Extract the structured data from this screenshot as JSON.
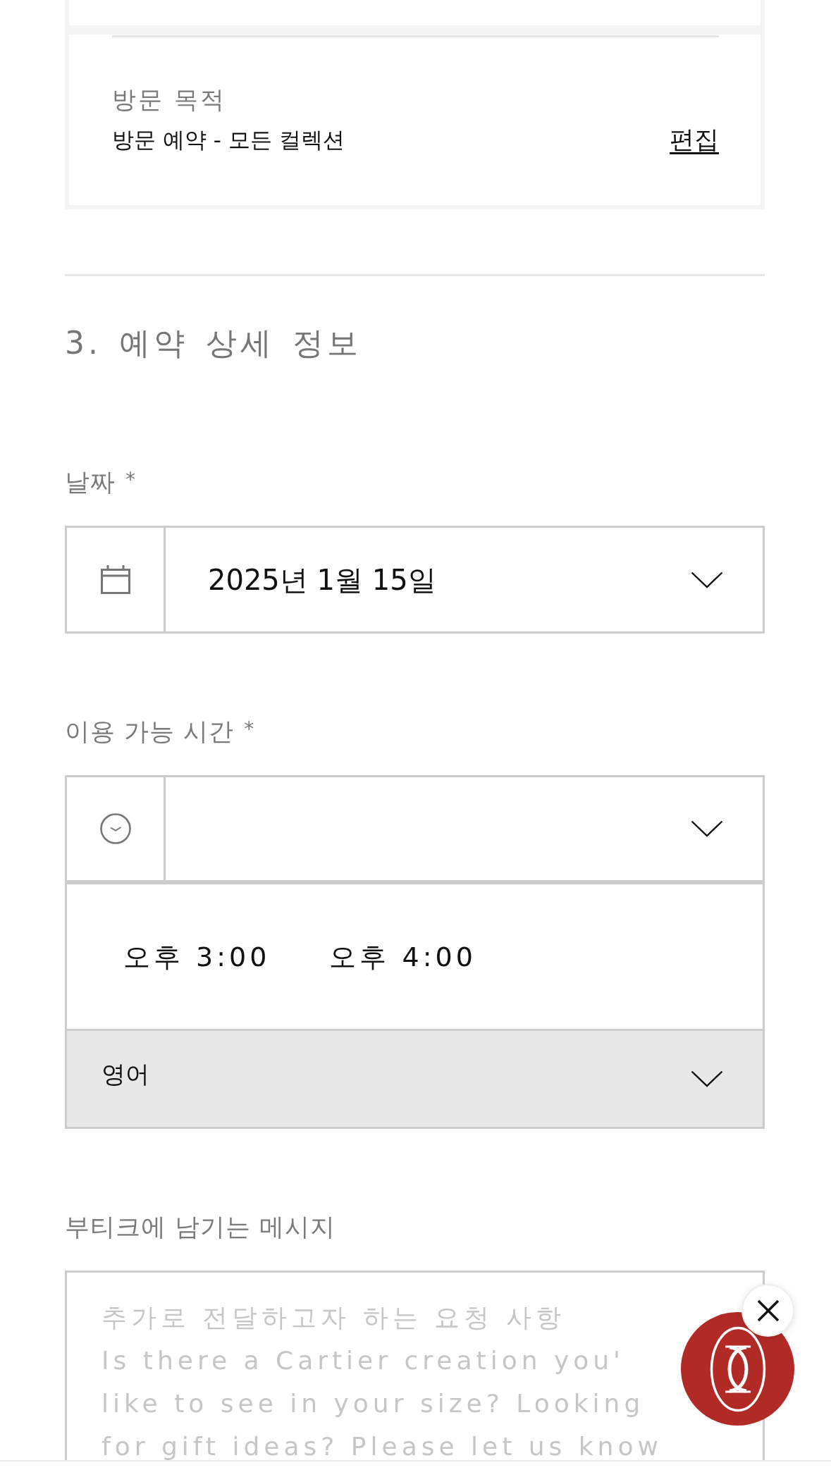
{
  "visit_card": {
    "label": "방문 목적",
    "value": "방문 예약 - 모든 컬렉션",
    "edit_link": "편집"
  },
  "section": {
    "title": "3. 예약 상세 정보"
  },
  "date_field": {
    "label": "날짜",
    "required_mark": "*",
    "value": "2025년 1월 15일"
  },
  "time_field": {
    "label": "이용 가능 시간",
    "required_mark": "*",
    "expanded": true,
    "options": [
      {
        "label": "오후 3:00",
        "selected": false
      },
      {
        "label": "오후 4:00",
        "selected": false
      }
    ]
  },
  "language_select": {
    "value": "영어"
  },
  "message_field": {
    "label": "부티크에 남기는 메시지",
    "placeholder": "추가로 전달하고자 하는 요청 사항\nIs there a Cartier creation you'\nlike to see in your size? Looking\nfor gift ideas? Please let us know"
  }
}
